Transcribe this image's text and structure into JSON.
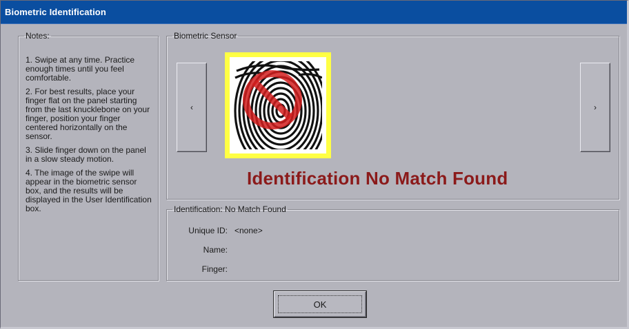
{
  "window": {
    "title": "Biometric Identification"
  },
  "notes": {
    "legend": "Notes:",
    "items": [
      "1. Swipe at any time. Practice enough times until you feel comfortable.",
      "2. For best results, place your finger flat on the panel starting from the last knucklebone on your finger, position your finger centered horizontally on the sensor.",
      "3. Slide finger down on the panel in a slow steady motion.",
      "4. The image of the swipe will appear in the biometric sensor box, and the results will be displayed in the User Identification box."
    ]
  },
  "sensor": {
    "legend": "Biometric Sensor",
    "prev_label": "‹",
    "next_label": "›",
    "status_text": "Identification No Match Found",
    "status_color": "#8b1a1a",
    "frame_color": "#ffff44",
    "icon": "fingerprint-no-match-icon"
  },
  "identification": {
    "legend": "Identification: No Match Found",
    "unique_id_label": "Unique ID:",
    "unique_id_value": "<none>",
    "name_label": "Name:",
    "name_value": "",
    "finger_label": "Finger:",
    "finger_value": ""
  },
  "buttons": {
    "ok_label": "OK"
  }
}
